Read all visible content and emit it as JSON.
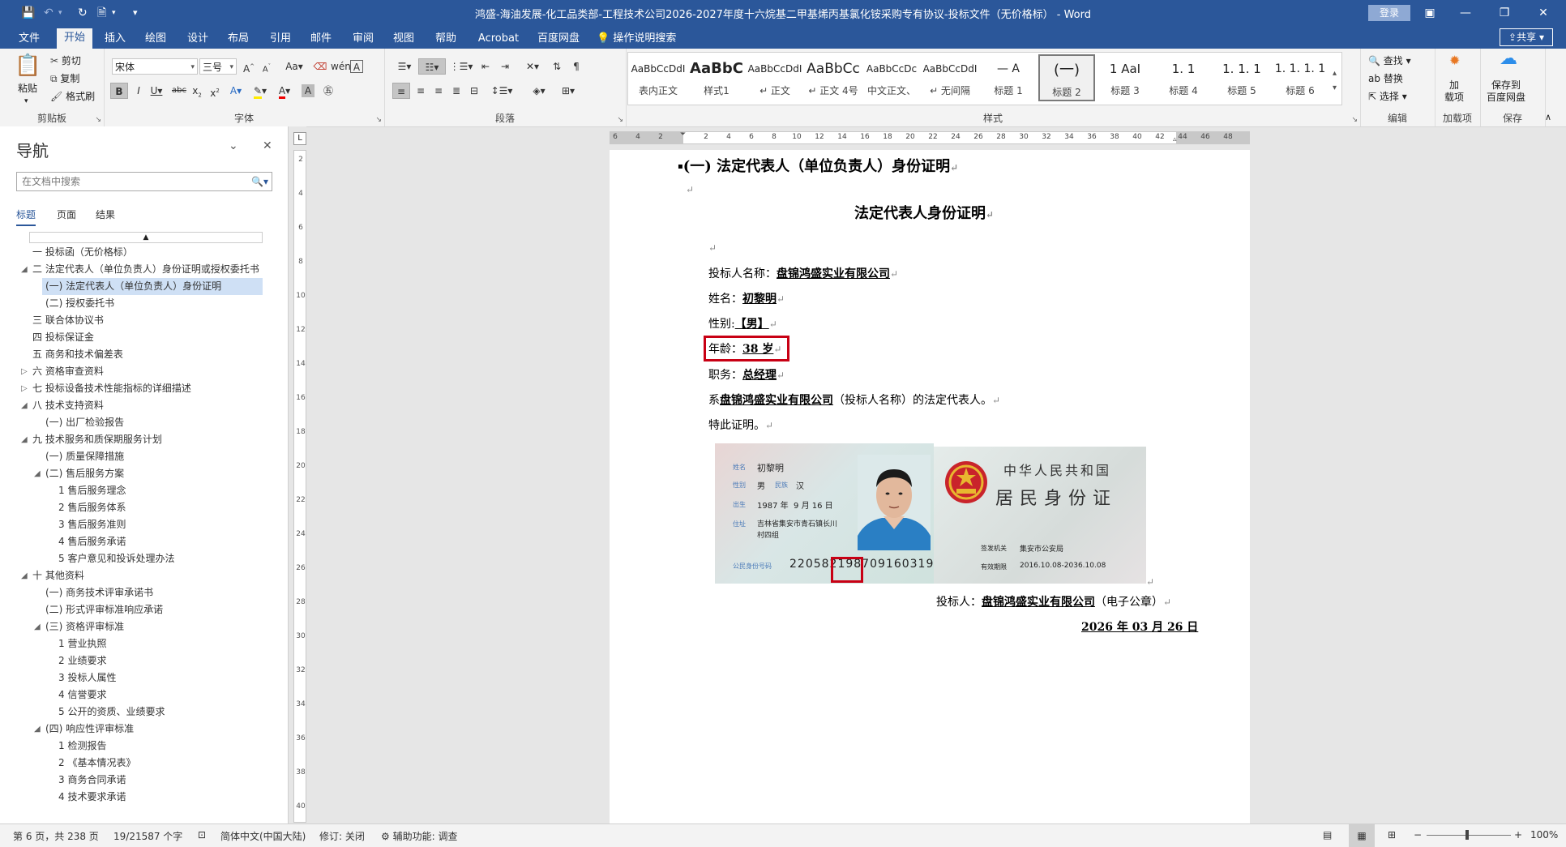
{
  "window": {
    "title": "鸿盛-海油发展-化工品类部-工程技术公司2026-2027年度十六烷基二甲基烯丙基氯化铵采购专有协议-投标文件（无价格标） - Word",
    "login": "登录"
  },
  "tabs": [
    "文件",
    "开始",
    "插入",
    "绘图",
    "设计",
    "布局",
    "引用",
    "邮件",
    "审阅",
    "视图",
    "帮助",
    "Acrobat",
    "百度网盘"
  ],
  "tell_me": "操作说明搜索",
  "share": "共享",
  "ribbon": {
    "clipboard": {
      "label": "剪贴板",
      "paste": "粘贴",
      "cut": "剪切",
      "copy": "复制",
      "format_painter": "格式刷"
    },
    "font": {
      "label": "字体",
      "name": "宋体",
      "size": "三号"
    },
    "paragraph": {
      "label": "段落"
    },
    "styles": {
      "label": "样式",
      "items": [
        {
          "preview": "AaBbCcDdI",
          "name": "表内正文"
        },
        {
          "preview": "AaBbC",
          "name": "样式1"
        },
        {
          "preview": "AaBbCcDdI",
          "name": "↵ 正文"
        },
        {
          "preview": "AaBbCc",
          "name": "↵ 正文 4号"
        },
        {
          "preview": "AaBbCcDc",
          "name": "中文正文、"
        },
        {
          "preview": "AaBbCcDdI",
          "name": "↵ 无间隔"
        },
        {
          "preview": "—  A",
          "name": "标题 1"
        },
        {
          "preview": "(一)",
          "name": "标题 2"
        },
        {
          "preview": "1  AaI",
          "name": "标题 3"
        },
        {
          "preview": "1. 1",
          "name": "标题 4"
        },
        {
          "preview": "1. 1. 1",
          "name": "标题 5"
        },
        {
          "preview": "1. 1. 1. 1",
          "name": "标题 6"
        }
      ]
    },
    "editing": {
      "label": "编辑",
      "find": "查找",
      "replace": "替换",
      "select": "选择"
    },
    "addins": {
      "label": "加载项",
      "button": "加\n载项"
    },
    "save": {
      "label": "保存",
      "button": "保存到\n百度网盘"
    }
  },
  "nav": {
    "title": "导航",
    "search_placeholder": "在文档中搜索",
    "tabs": [
      "标题",
      "页面",
      "结果"
    ],
    "items": [
      {
        "text": "一 投标函（无价格标）",
        "level": 1,
        "arrow": ""
      },
      {
        "text": "二 法定代表人（单位负责人）身份证明或授权委托书",
        "level": 1,
        "arrow": "◢"
      },
      {
        "text": "(一) 法定代表人（单位负责人）身份证明",
        "level": 2,
        "arrow": "",
        "selected": true
      },
      {
        "text": "(二) 授权委托书",
        "level": 2,
        "arrow": ""
      },
      {
        "text": "三 联合体协议书",
        "level": 1,
        "arrow": ""
      },
      {
        "text": "四 投标保证金",
        "level": 1,
        "arrow": ""
      },
      {
        "text": "五 商务和技术偏差表",
        "level": 1,
        "arrow": ""
      },
      {
        "text": "六 资格审查资料",
        "level": 1,
        "arrow": "▷"
      },
      {
        "text": "七 投标设备技术性能指标的详细描述",
        "level": 1,
        "arrow": "▷"
      },
      {
        "text": "八 技术支持资料",
        "level": 1,
        "arrow": "◢"
      },
      {
        "text": "(一) 出厂检验报告",
        "level": 2,
        "arrow": ""
      },
      {
        "text": "九 技术服务和质保期服务计划",
        "level": 1,
        "arrow": "◢"
      },
      {
        "text": "(一) 质量保障措施",
        "level": 2,
        "arrow": ""
      },
      {
        "text": "(二) 售后服务方案",
        "level": 2,
        "arrow": "◢"
      },
      {
        "text": "1 售后服务理念",
        "level": 3,
        "arrow": ""
      },
      {
        "text": "2 售后服务体系",
        "level": 3,
        "arrow": ""
      },
      {
        "text": "3 售后服务准则",
        "level": 3,
        "arrow": ""
      },
      {
        "text": "4 售后服务承诺",
        "level": 3,
        "arrow": ""
      },
      {
        "text": "5 客户意见和投诉处理办法",
        "level": 3,
        "arrow": ""
      },
      {
        "text": "十 其他资料",
        "level": 1,
        "arrow": "◢"
      },
      {
        "text": "(一) 商务技术评审承诺书",
        "level": 2,
        "arrow": ""
      },
      {
        "text": "(二) 形式评审标准响应承诺",
        "level": 2,
        "arrow": ""
      },
      {
        "text": "(三) 资格评审标准",
        "level": 2,
        "arrow": "◢"
      },
      {
        "text": "1 营业执照",
        "level": 3,
        "arrow": ""
      },
      {
        "text": "2 业绩要求",
        "level": 3,
        "arrow": ""
      },
      {
        "text": "3 投标人属性",
        "level": 3,
        "arrow": ""
      },
      {
        "text": "4 信誉要求",
        "level": 3,
        "arrow": ""
      },
      {
        "text": "5 公开的资质、业绩要求",
        "level": 3,
        "arrow": ""
      },
      {
        "text": "(四) 响应性评审标准",
        "level": 2,
        "arrow": "◢"
      },
      {
        "text": "1 检测报告",
        "level": 3,
        "arrow": ""
      },
      {
        "text": "2 《基本情况表》",
        "level": 3,
        "arrow": ""
      },
      {
        "text": "3 商务合同承诺",
        "level": 3,
        "arrow": ""
      },
      {
        "text": "4 技术要求承诺",
        "level": 3,
        "arrow": ""
      }
    ]
  },
  "hruler_ticks": [
    "6",
    "4",
    "2",
    "",
    "2",
    "4",
    "6",
    "8",
    "10",
    "12",
    "14",
    "16",
    "18",
    "20",
    "22",
    "24",
    "26",
    "28",
    "30",
    "32",
    "34",
    "36",
    "38",
    "40",
    "42",
    "44",
    "46",
    "48"
  ],
  "vruler_ticks": [
    "2",
    "4",
    "6",
    "8",
    "10",
    "12",
    "14",
    "16",
    "18",
    "20",
    "22",
    "24",
    "26",
    "28",
    "30",
    "32",
    "34",
    "36",
    "38",
    "40"
  ],
  "document": {
    "heading": "(一)  法定代表人（单位负责人）身份证明",
    "title": "法定代表人身份证明",
    "bidder_label": "投标人名称：",
    "bidder_name": "盘锦鸿盛实业有限公司",
    "name_label": "姓名：",
    "name_value": "初黎明",
    "gender_label": "性别:",
    "gender_value": "【男】",
    "age_label": "年龄：",
    "age_value": "38 岁",
    "position_label": "职务：",
    "position_value": "总经理",
    "statement_prefix": "系",
    "statement_company": "盘锦鸿盛实业有限公司",
    "statement_suffix": "（投标人名称）的法定代表人。",
    "certify": "特此证明。",
    "sign_label": "投标人：",
    "sign_company": "盘锦鸿盛实业有限公司",
    "sign_suffix": "（电子公章）",
    "date": "2026 年 03 月 26 日",
    "para_mark": "↵"
  },
  "id_card": {
    "front": {
      "name_label": "姓名",
      "name": "初黎明",
      "gender_label": "性别",
      "gender": "男",
      "ethnic_label": "民族",
      "ethnic": "汉",
      "birth_label": "出生",
      "birth_year": "1987",
      "birth_year_unit": "年",
      "birth_month": "9",
      "birth_month_unit": "月",
      "birth_day": "16",
      "birth_day_unit": "日",
      "addr_label": "住址",
      "addr_line1": "吉林省集安市青石镇长川",
      "addr_line2": "村四组",
      "id_label": "公民身份号码",
      "id_part1": "220582",
      "id_part2": "1987",
      "id_part3": "09160319"
    },
    "back": {
      "country": "中华人民共和国",
      "title": "居民身份证",
      "authority_label": "签发机关",
      "authority": "集安市公安局",
      "validity_label": "有效期限",
      "validity": "2016.10.08-2036.10.08"
    }
  },
  "status": {
    "page": "第 6 页，共 238 页",
    "words": "19/21587 个字",
    "language": "简体中文(中国大陆)",
    "revision": "修订: 关闭",
    "accessibility": "辅助功能: 调查",
    "zoom": "100%"
  }
}
